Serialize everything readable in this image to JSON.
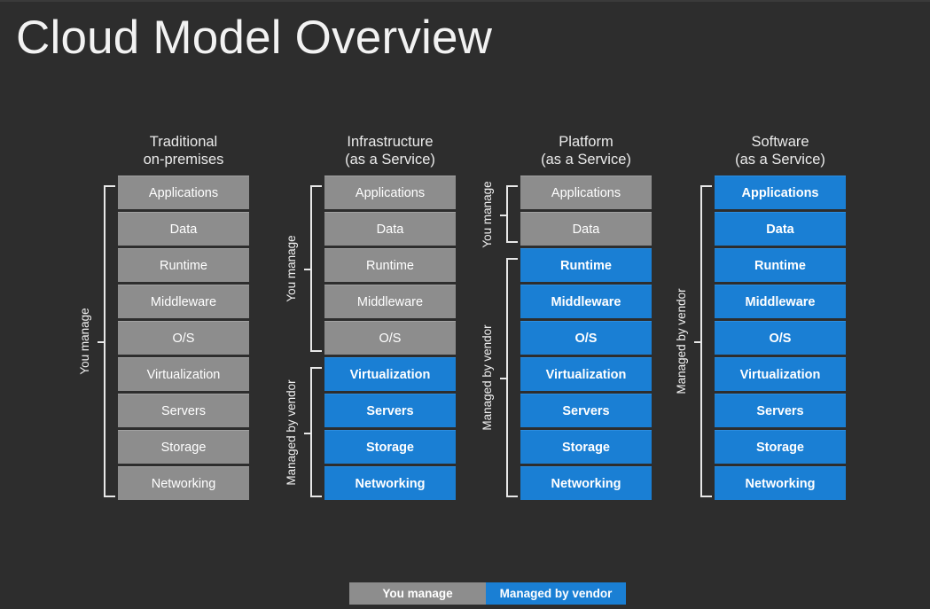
{
  "slide": {
    "title": "Cloud Model Overview",
    "background_color": "#2d2d2d",
    "gray_color": "#8d8d8d",
    "blue_color": "#1a7fd4"
  },
  "columns": [
    {
      "header_line1": "Traditional",
      "header_line2": "on-premises",
      "layers": [
        {
          "label": "Applications",
          "owner": "gray"
        },
        {
          "label": "Data",
          "owner": "gray"
        },
        {
          "label": "Runtime",
          "owner": "gray"
        },
        {
          "label": "Middleware",
          "owner": "gray"
        },
        {
          "label": "O/S",
          "owner": "gray"
        },
        {
          "label": "Virtualization",
          "owner": "gray"
        },
        {
          "label": "Servers",
          "owner": "gray"
        },
        {
          "label": "Storage",
          "owner": "gray"
        },
        {
          "label": "Networking",
          "owner": "gray"
        }
      ],
      "brackets": [
        {
          "label": "You manage",
          "start": 0,
          "end": 8
        }
      ]
    },
    {
      "header_line1": "Infrastructure",
      "header_line2": "(as a Service)",
      "layers": [
        {
          "label": "Applications",
          "owner": "gray"
        },
        {
          "label": "Data",
          "owner": "gray"
        },
        {
          "label": "Runtime",
          "owner": "gray"
        },
        {
          "label": "Middleware",
          "owner": "gray"
        },
        {
          "label": "O/S",
          "owner": "gray"
        },
        {
          "label": "Virtualization",
          "owner": "blue"
        },
        {
          "label": "Servers",
          "owner": "blue"
        },
        {
          "label": "Storage",
          "owner": "blue"
        },
        {
          "label": "Networking",
          "owner": "blue"
        }
      ],
      "brackets": [
        {
          "label": "You manage",
          "start": 0,
          "end": 4
        },
        {
          "label": "Managed by vendor",
          "start": 5,
          "end": 8
        }
      ]
    },
    {
      "header_line1": "Platform",
      "header_line2": "(as a Service)",
      "layers": [
        {
          "label": "Applications",
          "owner": "gray"
        },
        {
          "label": "Data",
          "owner": "gray"
        },
        {
          "label": "Runtime",
          "owner": "blue"
        },
        {
          "label": "Middleware",
          "owner": "blue"
        },
        {
          "label": "O/S",
          "owner": "blue"
        },
        {
          "label": "Virtualization",
          "owner": "blue"
        },
        {
          "label": "Servers",
          "owner": "blue"
        },
        {
          "label": "Storage",
          "owner": "blue"
        },
        {
          "label": "Networking",
          "owner": "blue"
        }
      ],
      "brackets": [
        {
          "label": "You manage",
          "start": 0,
          "end": 1
        },
        {
          "label": "Managed by vendor",
          "start": 2,
          "end": 8
        }
      ]
    },
    {
      "header_line1": "Software",
      "header_line2": "(as a Service)",
      "layers": [
        {
          "label": "Applications",
          "owner": "blue"
        },
        {
          "label": "Data",
          "owner": "blue"
        },
        {
          "label": "Runtime",
          "owner": "blue"
        },
        {
          "label": "Middleware",
          "owner": "blue"
        },
        {
          "label": "O/S",
          "owner": "blue"
        },
        {
          "label": "Virtualization",
          "owner": "blue"
        },
        {
          "label": "Servers",
          "owner": "blue"
        },
        {
          "label": "Storage",
          "owner": "blue"
        },
        {
          "label": "Networking",
          "owner": "blue"
        }
      ],
      "brackets": [
        {
          "label": "Managed by vendor",
          "start": 0,
          "end": 8
        }
      ]
    }
  ],
  "legend": [
    {
      "label": "You manage",
      "owner": "gray"
    },
    {
      "label": "Managed by vendor",
      "owner": "blue"
    }
  ]
}
